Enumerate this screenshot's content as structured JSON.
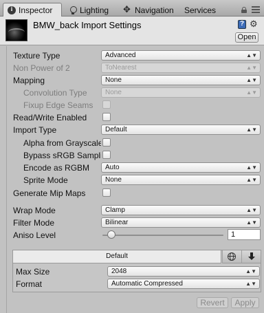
{
  "tabs": [
    {
      "label": "Inspector",
      "icon": "info-icon",
      "active": true
    },
    {
      "label": "Lighting",
      "icon": "lightbulb-icon"
    },
    {
      "label": "Navigation",
      "icon": "navigation-icon"
    },
    {
      "label": "Services",
      "icon": ""
    }
  ],
  "header": {
    "title": "BMW_back Import Settings",
    "open_label": "Open"
  },
  "fields": {
    "texture_type": {
      "label": "Texture Type",
      "value": "Advanced"
    },
    "non_power_of_2": {
      "label": "Non Power of 2",
      "value": "ToNearest",
      "disabled": true
    },
    "mapping": {
      "label": "Mapping",
      "value": "None"
    },
    "convolution_type": {
      "label": "Convolution Type",
      "value": "None",
      "disabled": true
    },
    "fixup_edge_seams": {
      "label": "Fixup Edge Seams",
      "checked": false,
      "disabled": true
    },
    "read_write_enabled": {
      "label": "Read/Write Enabled",
      "checked": false
    },
    "import_type": {
      "label": "Import Type",
      "value": "Default"
    },
    "alpha_from_grayscale": {
      "label": "Alpha from Grayscale",
      "checked": false
    },
    "bypass_srgb_sampling": {
      "label": "Bypass sRGB Sampling",
      "checked": false
    },
    "encode_as_rgbm": {
      "label": "Encode as RGBM",
      "value": "Auto"
    },
    "sprite_mode": {
      "label": "Sprite Mode",
      "value": "None"
    },
    "generate_mip_maps": {
      "label": "Generate Mip Maps",
      "checked": false
    },
    "wrap_mode": {
      "label": "Wrap Mode",
      "value": "Clamp"
    },
    "filter_mode": {
      "label": "Filter Mode",
      "value": "Bilinear"
    },
    "aniso_level": {
      "label": "Aniso Level",
      "value": "1",
      "slider_fraction": 0.0
    }
  },
  "platform": {
    "tab_label": "Default",
    "web_icon": "globe-icon",
    "standalone_icon": "download-icon",
    "max_size": {
      "label": "Max Size",
      "value": "2048"
    },
    "format": {
      "label": "Format",
      "value": "Automatic Compressed"
    }
  },
  "buttons": {
    "revert": "Revert",
    "apply": "Apply"
  }
}
